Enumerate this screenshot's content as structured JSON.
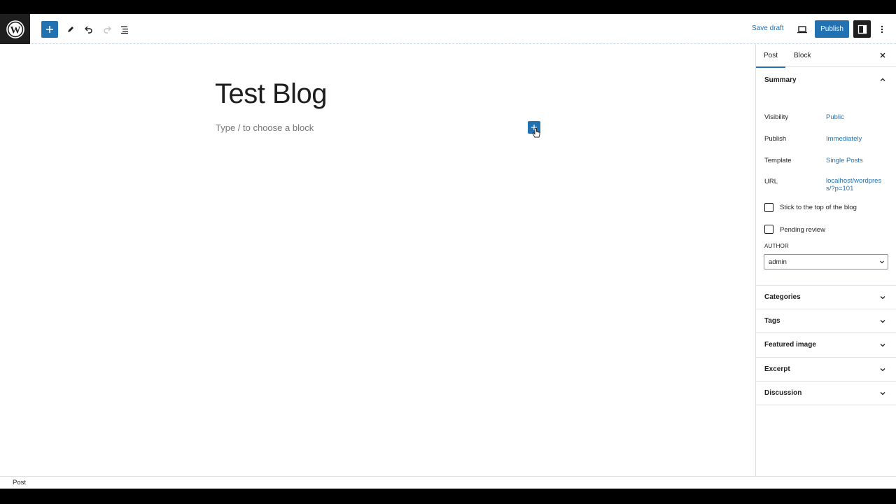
{
  "header": {
    "save_draft": "Save draft",
    "publish": "Publish"
  },
  "editor": {
    "title": "Test Blog",
    "placeholder": "Type / to choose a block"
  },
  "sidebar": {
    "tabs": [
      "Post",
      "Block"
    ],
    "summary": {
      "title": "Summary",
      "rows": [
        {
          "label": "Visibility",
          "value": "Public"
        },
        {
          "label": "Publish",
          "value": "Immediately"
        },
        {
          "label": "Template",
          "value": "Single Posts"
        },
        {
          "label": "URL",
          "value": "localhost/wordpress/?p=101"
        }
      ],
      "checkboxes": [
        "Stick to the top of the blog",
        "Pending review"
      ],
      "author_label": "AUTHOR",
      "author_value": "admin"
    },
    "panels": [
      "Categories",
      "Tags",
      "Featured image",
      "Excerpt",
      "Discussion"
    ]
  },
  "footer": {
    "breadcrumb": "Post"
  },
  "colors": {
    "accent": "#2271b1",
    "dark": "#1e1e1e"
  },
  "icons": [
    "wordpress-logo-icon",
    "plus-icon",
    "pencil-icon",
    "undo-icon",
    "redo-icon",
    "list-view-icon",
    "preview-icon",
    "settings-sidebar-icon",
    "more-vertical-icon",
    "close-icon",
    "chevron-up-icon",
    "chevron-down-icon",
    "pointer-cursor-icon"
  ]
}
